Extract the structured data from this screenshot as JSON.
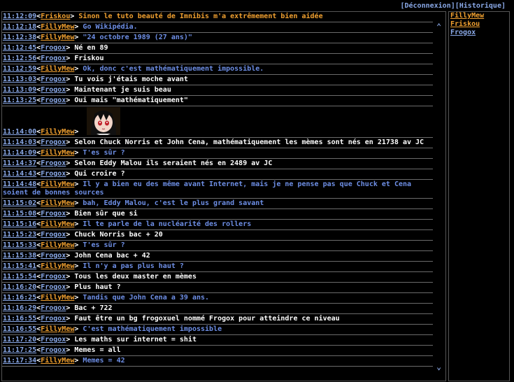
{
  "topbar": {
    "deconnexion": "[Déconnexion]",
    "historique": "[Historique]"
  },
  "colors": {
    "frogox": "#8aa9e8",
    "orange": "#f0a030",
    "blue": "#6e8fe6"
  },
  "messages": [
    {
      "time": "11:12:09",
      "user": "Friskou",
      "text": "Sinon le tuto beauté de Imnibis m'a extrêmement bien aidée"
    },
    {
      "time": "11:12:18",
      "user": "FillyMew",
      "text": "Go Wikipédia."
    },
    {
      "time": "11:12:38",
      "user": "FillyMew",
      "text": "\"24 octobre 1989 (27 ans)\""
    },
    {
      "time": "11:12:45",
      "user": "Frogox",
      "text": "Né en 89"
    },
    {
      "time": "11:12:56",
      "user": "Frogox",
      "text": "Friskou"
    },
    {
      "time": "11:12:59",
      "user": "FillyMew",
      "text": "Ok, donc c'est mathématiquement impossible."
    },
    {
      "time": "11:13:03",
      "user": "Frogox",
      "text": "Tu vois j'étais moche avant"
    },
    {
      "time": "11:13:09",
      "user": "Frogox",
      "text": "Maintenant je suis beau"
    },
    {
      "time": "11:13:25",
      "user": "Frogox",
      "text": "Oui mais \"mathématiquement\""
    },
    {
      "time": "11:14:00",
      "user": "FillyMew",
      "text": ""
    },
    {
      "time": "11:14:03",
      "user": "Frogox",
      "text": "Selon Chuck Norris et John Cena, mathématiquement les mèmes sont nés en 21738 av JC"
    },
    {
      "time": "11:14:09",
      "user": "FillyMew",
      "text": "T'es sûr ?"
    },
    {
      "time": "11:14:37",
      "user": "Frogox",
      "text": "Selon Eddy Malou ils seraient nés en 2489 av JC"
    },
    {
      "time": "11:14:43",
      "user": "Frogox",
      "text": "Qui croire ?"
    },
    {
      "time": "11:14:48",
      "user": "FillyMew",
      "text": "Il y a bien eu des même avant Internet, mais je ne pense pas que Chuck et Cena soient de bonnes sources"
    },
    {
      "time": "11:15:02",
      "user": "FillyMew",
      "text": "bah, Eddy Malou, c'est le plus grand savant"
    },
    {
      "time": "11:15:08",
      "user": "Frogox",
      "text": "Bien sûr que si"
    },
    {
      "time": "11:15:16",
      "user": "FillyMew",
      "text": "Il te parle de la nucléarité des rollers"
    },
    {
      "time": "11:15:23",
      "user": "Frogox",
      "text": "Chuck Norris bac + 20"
    },
    {
      "time": "11:15:33",
      "user": "FillyMew",
      "text": "T'es sûr ?"
    },
    {
      "time": "11:15:38",
      "user": "Frogox",
      "text": "John Cena bac + 42"
    },
    {
      "time": "11:15:41",
      "user": "FillyMew",
      "text": "Il n'y a pas plus haut ?"
    },
    {
      "time": "11:15:54",
      "user": "Frogox",
      "text": "Tous les deux master en mèmes"
    },
    {
      "time": "11:16:20",
      "user": "Frogox",
      "text": "Plus haut ?"
    },
    {
      "time": "11:16:25",
      "user": "FillyMew",
      "text": "Tandis que John Cena a 39 ans."
    },
    {
      "time": "11:16:29",
      "user": "Frogox",
      "text": "Bac + 722"
    },
    {
      "time": "11:16:55",
      "user": "Frogox",
      "text": "Faut être un bg frogoxuel nommé Frogox pour atteindre ce niveau"
    },
    {
      "time": "11:16:55",
      "user": "FillyMew",
      "text": "C'est mathématiquement impossible"
    },
    {
      "time": "11:17:20",
      "user": "Frogox",
      "text": "Les maths sur internet = shit"
    },
    {
      "time": "11:17:25",
      "user": "Frogox",
      "text": "Memes = all"
    },
    {
      "time": "11:17:34",
      "user": "FillyMew",
      "text": "Memes = 42"
    }
  ],
  "users": [
    {
      "name": "FillyMew"
    },
    {
      "name": "Friskou"
    },
    {
      "name": "Frogox"
    }
  ]
}
